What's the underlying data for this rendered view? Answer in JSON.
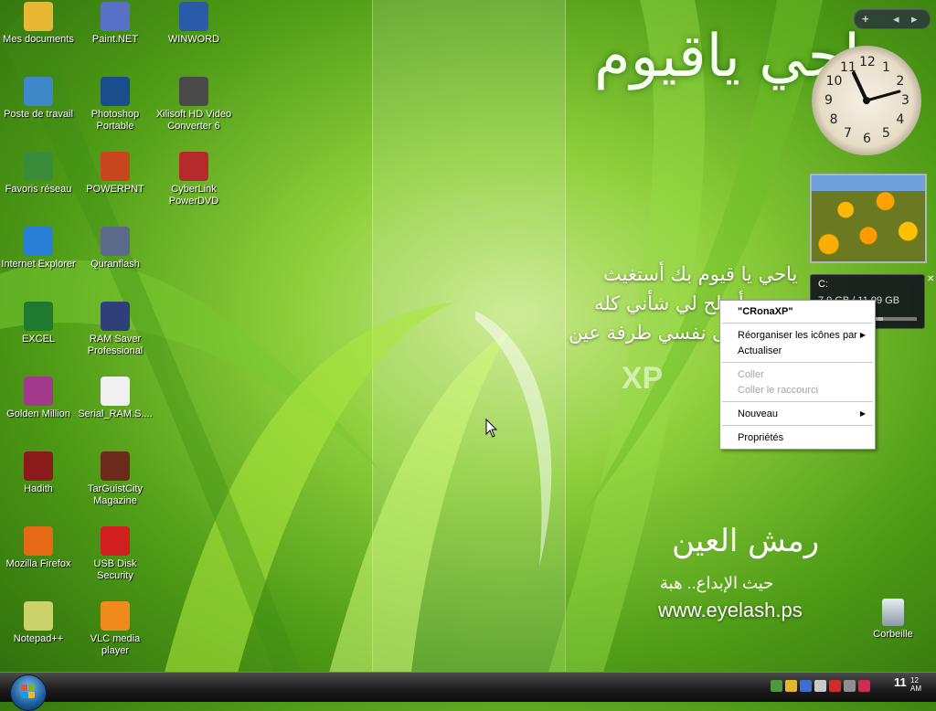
{
  "desktop": {
    "icons": [
      {
        "label": "Mes documents",
        "icon": "folder-icon",
        "color": "#e8b835"
      },
      {
        "label": "Poste de travail",
        "icon": "computer-icon",
        "color": "#3e87c8"
      },
      {
        "label": "Favoris réseau",
        "icon": "network-icon",
        "color": "#3a8c3a"
      },
      {
        "label": "Internet Explorer",
        "icon": "ie-icon",
        "color": "#2a7fd6"
      },
      {
        "label": "EXCEL",
        "icon": "excel-icon",
        "color": "#1f7a2f"
      },
      {
        "label": "Golden Million",
        "icon": "golden-million-icon",
        "color": "#a23a8c"
      },
      {
        "label": "Hadith",
        "icon": "hadith-icon",
        "color": "#8b1a1a"
      },
      {
        "label": "Mozilla Firefox",
        "icon": "firefox-icon",
        "color": "#e66a16"
      },
      {
        "label": "Notepad++",
        "icon": "notepad-icon",
        "color": "#cbd26a"
      },
      {
        "label": "Paint.NET",
        "icon": "paintnet-icon",
        "color": "#5970c7"
      },
      {
        "label": "Photoshop Portable",
        "icon": "photoshop-icon",
        "color": "#1b4c8c"
      },
      {
        "label": "POWERPNT",
        "icon": "powerpoint-icon",
        "color": "#c8461e"
      },
      {
        "label": "Quranflash",
        "icon": "quranflash-icon",
        "color": "#5b6a8a"
      },
      {
        "label": "RAM Saver Professional",
        "icon": "ramsaver-icon",
        "color": "#2f3f7a"
      },
      {
        "label": "Serial_RAM.S....",
        "icon": "text-file-icon",
        "color": "#f0f0f0"
      },
      {
        "label": "TarGuistCity Magazine",
        "icon": "magazine-icon",
        "color": "#6d2a1a"
      },
      {
        "label": "USB Disk Security",
        "icon": "usb-security-icon",
        "color": "#d11f1f"
      },
      {
        "label": "VLC media player",
        "icon": "vlc-icon",
        "color": "#f08a1a"
      },
      {
        "label": "WINWORD",
        "icon": "word-icon",
        "color": "#2a5aa8"
      },
      {
        "label": "Xilisoft HD Video Converter 6",
        "icon": "film-reel-icon",
        "color": "#4a4a4a"
      },
      {
        "label": "CyberLink PowerDVD",
        "icon": "dvd-icon",
        "color": "#b52a2a"
      }
    ],
    "recycle_bin": "Corbeille"
  },
  "wallpaper": {
    "arabic_title": "ياحي ياقيوم",
    "arabic_lines": [
      "ياحي يا قيوم بك أستغيث",
      "أصلح لي شأني كله",
      "ولا تكلني إلى نفسي طرفة عين"
    ],
    "xp_text": "XP",
    "signature": "رمش العين",
    "motto": "حيث الإبداع.. هبة",
    "website": "www.eyelash.ps"
  },
  "sidebar": {
    "add_button": "+",
    "prev": "◂",
    "next": "▸",
    "clock_numbers": [
      "12",
      "1",
      "2",
      "3",
      "4",
      "5",
      "6",
      "7",
      "8",
      "9",
      "10",
      "11"
    ],
    "drive": {
      "label": "C:",
      "usage": "7.9 GB / 11.99 GB",
      "used_fraction": 0.66
    }
  },
  "context_menu": {
    "title": "\"CRonaXP\"",
    "items": [
      {
        "label": "Réorganiser les icônes par",
        "submenu": true,
        "disabled": false
      },
      {
        "label": "Actualiser",
        "submenu": false,
        "disabled": false
      },
      {
        "label": "Coller",
        "submenu": false,
        "disabled": true
      },
      {
        "label": "Coller le raccourci",
        "submenu": false,
        "disabled": true
      },
      {
        "label": "Nouveau",
        "submenu": true,
        "disabled": false
      },
      {
        "label": "Propriétés",
        "submenu": false,
        "disabled": false
      }
    ]
  },
  "taskbar": {
    "time": "11",
    "time_minutes": "12",
    "ampm": "AM",
    "tray_icons": [
      "network-tray-icon",
      "security-tray-icon",
      "notes-tray-icon",
      "display-tray-icon",
      "usb-tray-icon",
      "volume-tray-icon",
      "shield-tray-icon"
    ]
  }
}
